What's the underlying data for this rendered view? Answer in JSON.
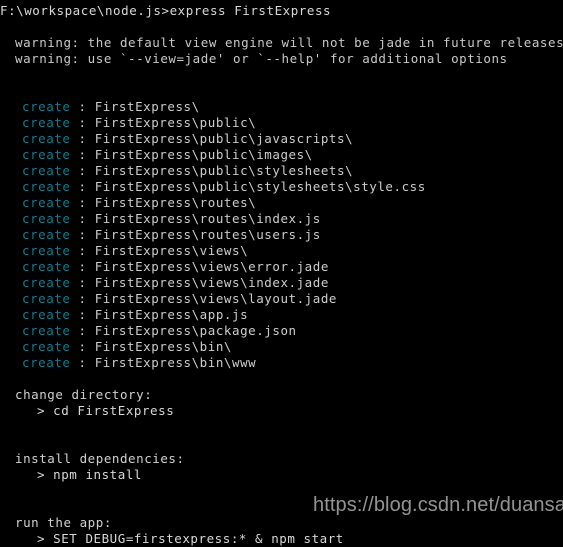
{
  "terminal": {
    "background_color": "#000000",
    "default_text_color": "#cccccc",
    "accent_color": "#0f7d8e",
    "prompt_line": "F:\\workspace\\node.js>express FirstExpress",
    "warnings": [
      "warning: the default view engine will not be jade in future releases",
      "warning: use `--view=jade' or `--help' for additional options"
    ],
    "create_label": "create",
    "create_separator": ":",
    "created_paths": [
      "FirstExpress\\",
      "FirstExpress\\public\\",
      "FirstExpress\\public\\javascripts\\",
      "FirstExpress\\public\\images\\",
      "FirstExpress\\public\\stylesheets\\",
      "FirstExpress\\public\\stylesheets\\style.css",
      "FirstExpress\\routes\\",
      "FirstExpress\\routes\\index.js",
      "FirstExpress\\routes\\users.js",
      "FirstExpress\\views\\",
      "FirstExpress\\views\\error.jade",
      "FirstExpress\\views\\index.jade",
      "FirstExpress\\views\\layout.jade",
      "FirstExpress\\app.js",
      "FirstExpress\\package.json",
      "FirstExpress\\bin\\",
      "FirstExpress\\bin\\www"
    ],
    "sections": [
      {
        "heading": "change directory:",
        "command": "> cd FirstExpress"
      },
      {
        "heading": "install dependencies:",
        "command": "> npm install"
      },
      {
        "heading": "run the app:",
        "command": "> SET DEBUG=firstexpress:* & npm start"
      }
    ]
  },
  "watermark": {
    "text": "https://blog.csdn.net/duansamve"
  }
}
